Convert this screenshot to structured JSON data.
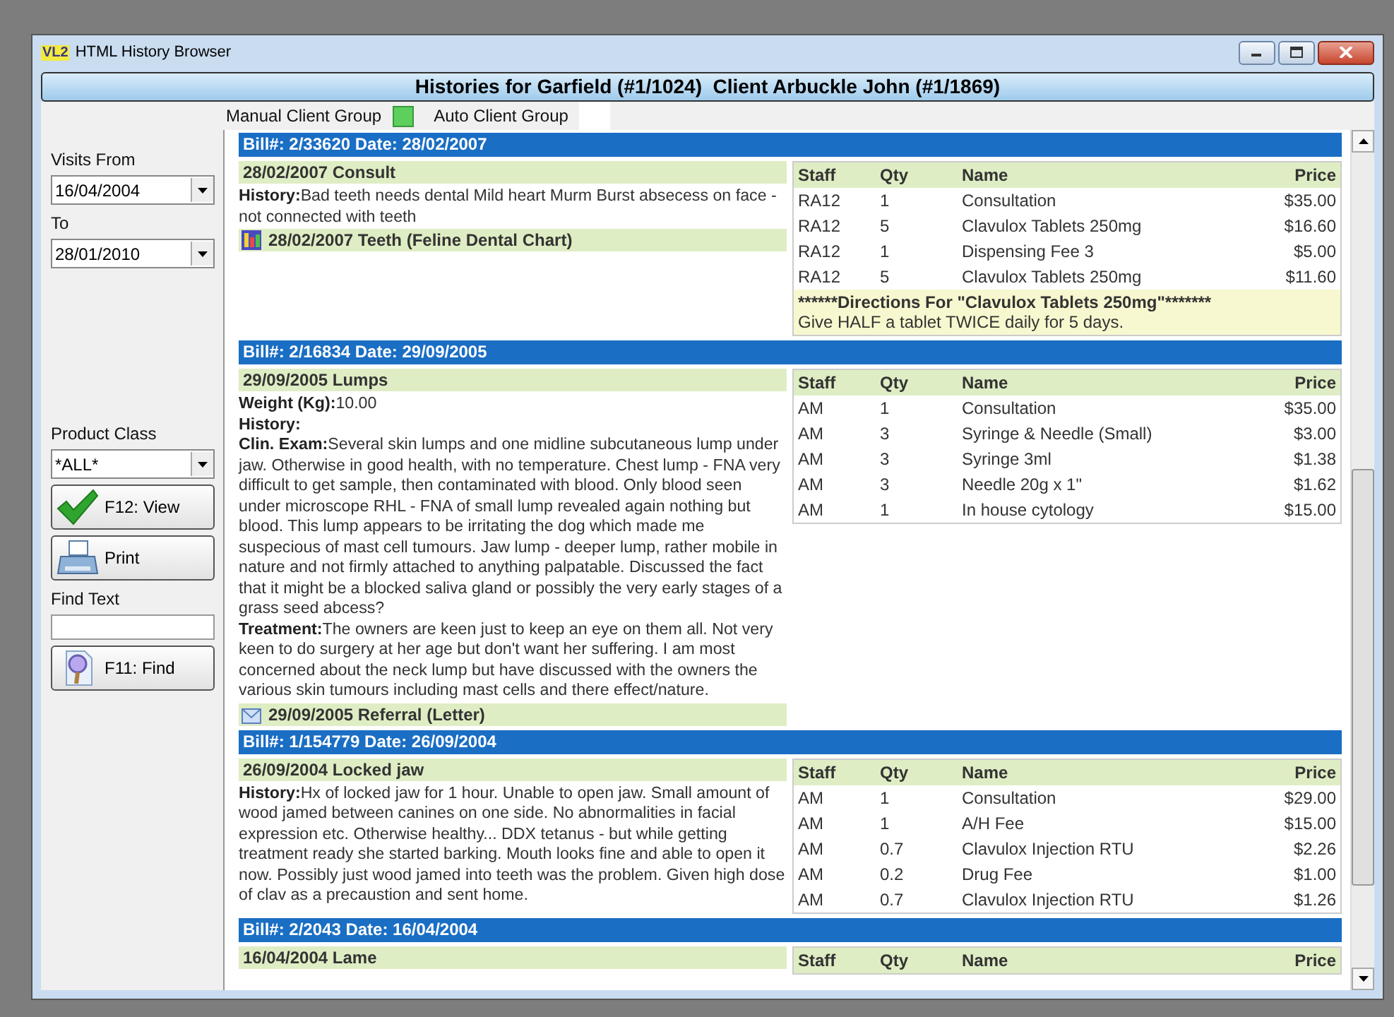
{
  "window": {
    "title": "HTML History Browser",
    "logo": "VL2"
  },
  "header_title": "Histories for Garfield (#1/1024)  Client Arbuckle John (#1/1869)",
  "client_groups": [
    {
      "label": "Manual Client Group",
      "on": true
    },
    {
      "label": "Auto Client Group",
      "on": false
    }
  ],
  "sidebar": {
    "visits_from_label": "Visits From",
    "visits_from": "16/04/2004",
    "to_label": "To",
    "to": "28/01/2010",
    "product_class_label": "Product Class",
    "product_class": "*ALL*",
    "buttons": [
      {
        "kind": "view",
        "label": "F12: View"
      },
      {
        "kind": "print",
        "label": "Print"
      }
    ],
    "find_label": "Find Text",
    "find_button": {
      "kind": "find",
      "label": "F11: Find"
    }
  },
  "bills": [
    {
      "title": "Bill#: 2/33620 Date: 28/02/2007",
      "consult": "28/02/2007 Consult",
      "paragraphs": [
        "**History:**Bad teeth needs dental Mild heart Murm Burst absecess on face - not connected with teeth"
      ],
      "attachments": [
        {
          "kind": "chart",
          "label": "28/02/2007 Teeth (Feline Dental Chart)"
        }
      ],
      "columns": [
        "Staff",
        "Qty",
        "Name",
        "Price"
      ],
      "rows": [
        [
          "RA12",
          "1",
          "Consultation",
          "$35.00"
        ],
        [
          "RA12",
          "5",
          "Clavulox Tablets 250mg",
          "$16.60"
        ],
        [
          "RA12",
          "1",
          "Dispensing Fee 3",
          "$5.00"
        ],
        [
          "RA12",
          "5",
          "Clavulox Tablets 250mg",
          "$11.60"
        ]
      ],
      "directions": {
        "heading": "******Directions For \"Clavulox Tablets 250mg\"*******",
        "text": "Give HALF a tablet TWICE daily for 5 days."
      }
    },
    {
      "title": "Bill#: 2/16834 Date: 29/09/2005",
      "consult": "29/09/2005 Lumps",
      "paragraphs": [
        "**Weight (Kg):**10.00",
        "**History:**",
        "**Clin. Exam:**Several skin lumps and one midline subcutaneous lump under jaw. Otherwise in good health, with no temperature. Chest lump - FNA very difficult to get sample, then contaminated with blood. Only blood seen under microscope RHL - FNA of small lump revealed again nothing but blood. This lump appears to be irritating the dog which made me suspecious of mast cell tumours. Jaw lump - deeper lump, rather mobile in nature and not firmly attached to anything palpatable. Discussed the fact that it might be a blocked saliva gland or possibly the very early stages of a grass seed abcess?",
        "**Treatment:**The owners are keen just to keep an eye on them all. Not very keen to do surgery at her age but don't want her suffering. I am most concerned about the neck lump but have discussed with the owners the various skin tumours including mast cells and there effect/nature."
      ],
      "attachments": [
        {
          "kind": "letter",
          "label": "29/09/2005 Referral (Letter)"
        }
      ],
      "columns": [
        "Staff",
        "Qty",
        "Name",
        "Price"
      ],
      "rows": [
        [
          "AM",
          "1",
          "Consultation",
          "$35.00"
        ],
        [
          "AM",
          "3",
          "Syringe & Needle (Small)",
          "$3.00"
        ],
        [
          "AM",
          "3",
          "Syringe 3ml",
          "$1.38"
        ],
        [
          "AM",
          "3",
          "Needle 20g x 1\"",
          "$1.62"
        ],
        [
          "AM",
          "1",
          "In house cytology",
          "$15.00"
        ]
      ]
    },
    {
      "title": "Bill#: 1/154779 Date: 26/09/2004",
      "consult": "26/09/2004 Locked jaw",
      "paragraphs": [
        "**History:**Hx of locked jaw for 1 hour. Unable to open jaw. Small amount of wood jamed between canines on one side. No abnormalities in facial expression etc. Otherwise healthy... DDX tetanus - but while getting treatment ready she started barking. Mouth looks fine and able to open it now. Possibly just wood jamed into teeth was the problem. Given high dose of clav as a precaustion and sent home."
      ],
      "columns": [
        "Staff",
        "Qty",
        "Name",
        "Price"
      ],
      "rows": [
        [
          "AM",
          "1",
          "Consultation",
          "$29.00"
        ],
        [
          "AM",
          "1",
          "A/H Fee",
          "$15.00"
        ],
        [
          "AM",
          "0.7",
          "Clavulox Injection RTU",
          "$2.26"
        ],
        [
          "AM",
          "0.2",
          "Drug Fee",
          "$1.00"
        ],
        [
          "AM",
          "0.7",
          "Clavulox Injection RTU",
          "$1.26"
        ]
      ]
    },
    {
      "title": "Bill#: 2/2043 Date: 16/04/2004",
      "consult": "16/04/2004 Lame",
      "columns": [
        "Staff",
        "Qty",
        "Name",
        "Price"
      ]
    }
  ]
}
